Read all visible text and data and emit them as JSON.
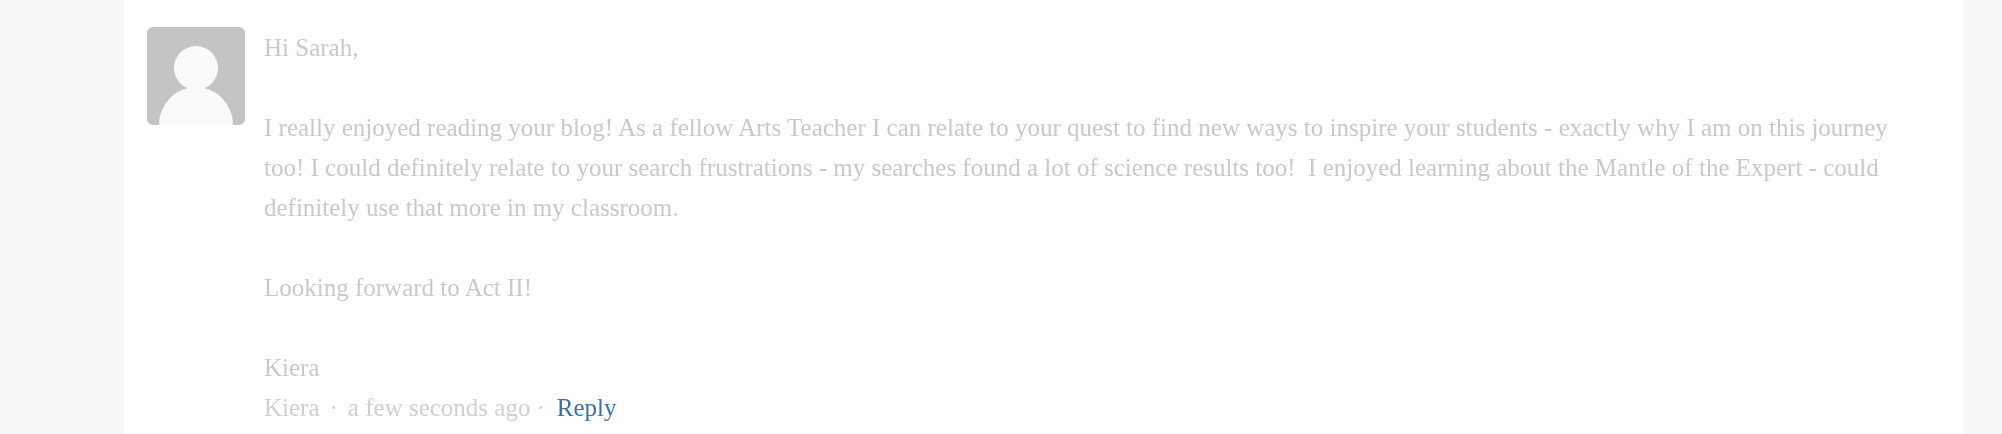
{
  "comment": {
    "paragraphs": [
      "Hi Sarah,",
      "I really enjoyed reading your blog! As a fellow Arts Teacher I can relate to your quest to find new ways to inspire your students - exactly why I am on this journey too! I could definitely relate to your search frustrations - my searches found a lot of science results too!  I enjoyed learning about the Mantle of the Expert - could definitely use that more in my classroom.",
      "Looking forward to Act II!",
      "Kiera"
    ],
    "meta": {
      "author": "Kiera",
      "separator_1": "·",
      "time": "a few seconds ago",
      "separator_2": "·",
      "reply": "Reply"
    }
  }
}
